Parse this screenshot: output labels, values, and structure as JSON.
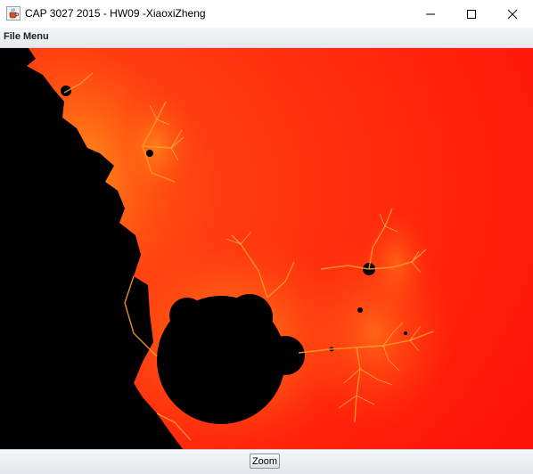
{
  "window": {
    "title": "CAP 3027 2015 - HW09 -XiaoxiZheng",
    "app_icon": "java-cup-icon",
    "controls": [
      "minimize-icon",
      "maximize-icon",
      "close-icon"
    ]
  },
  "menubar": {
    "items": [
      {
        "label": "File Menu"
      }
    ]
  },
  "canvas": {
    "content": "mandelbrot-fractal",
    "colors": {
      "set": "#000000",
      "background": "#ff2a10",
      "edge": "#ff7a10",
      "highlight": "#ffb030"
    }
  },
  "toolbar": {
    "zoom_label": "Zoom"
  }
}
